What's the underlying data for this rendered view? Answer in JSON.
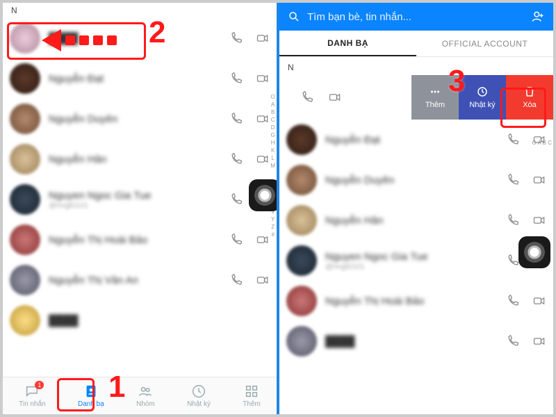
{
  "annotations": {
    "step1": "1",
    "step2": "2",
    "step3": "3"
  },
  "left": {
    "section_letter": "N",
    "contacts": [
      {
        "name": "████"
      },
      {
        "name": "Nguyễn Đạt"
      },
      {
        "name": "Nguyễn Duyên"
      },
      {
        "name": "Nguyễn Hân"
      },
      {
        "name": "Nguyen Ngoc Gia Tue",
        "sub": "@nngt0101"
      },
      {
        "name": "Nguyễn Thị Hoài Bảo"
      },
      {
        "name": "Nguyễn Thị Vân An"
      },
      {
        "name": "████"
      }
    ],
    "alpha_index": "O\nA\nB\nC\nD\nG\nH\nK\nL\nM\n\n\n\nT\nU\nV\nY\nZ\n#",
    "bottom": {
      "messages": {
        "label": "Tin nhắn",
        "badge": "1"
      },
      "contacts": {
        "label": "Danh bạ"
      },
      "groups": {
        "label": "Nhóm"
      },
      "timeline": {
        "label": "Nhật ký"
      },
      "more": {
        "label": "Thêm"
      }
    }
  },
  "right": {
    "search_placeholder": "Tìm bạn bè, tin nhắn...",
    "tabs": {
      "contacts": "DANH BẠ",
      "oa": "OFFICIAL ACCOUNT"
    },
    "section_letter": "N",
    "swipe_actions": {
      "more": "Thêm",
      "log": "Nhật ký",
      "delete": "Xóa"
    },
    "contacts": [
      {
        "name": "Nguyễn Đạt"
      },
      {
        "name": "Nguyễn Duyên"
      },
      {
        "name": "Nguyễn Hân"
      },
      {
        "name": "Nguyen Ngoc Gia Tue",
        "sub": "@nngt0101"
      },
      {
        "name": "Nguyễn Thị Hoài Bảo"
      },
      {
        "name": "████"
      }
    ],
    "alpha_index": "O\nA\nB\nC"
  }
}
